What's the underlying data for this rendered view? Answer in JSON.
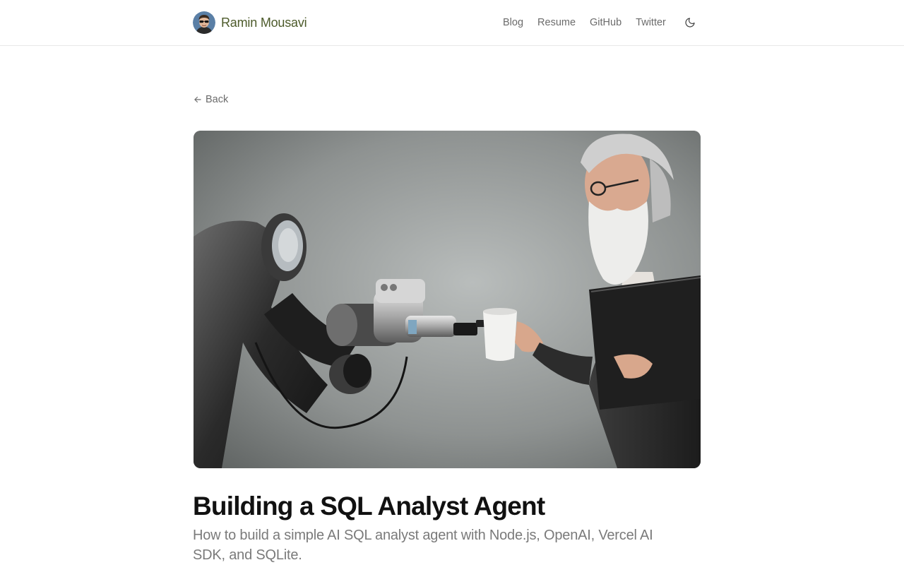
{
  "header": {
    "brand_name": "Ramin Mousavi",
    "nav": [
      {
        "label": "Blog"
      },
      {
        "label": "Resume"
      },
      {
        "label": "GitHub"
      },
      {
        "label": "Twitter"
      }
    ],
    "theme_toggle_icon": "moon-icon"
  },
  "article": {
    "back_label": "Back",
    "back_icon": "arrow-left-icon",
    "hero_image": "robot-arm-handing-coffee-cup-to-bearded-man-photo",
    "title": "Building a SQL Analyst Agent",
    "subtitle": "How to build a simple AI SQL analyst agent with Node.js, OpenAI, Vercel AI SDK, and SQLite."
  },
  "colors": {
    "brand": "#4d5b2b",
    "nav_text": "#6b6b6b",
    "title": "#111111",
    "subtitle": "#7a7a7a"
  }
}
